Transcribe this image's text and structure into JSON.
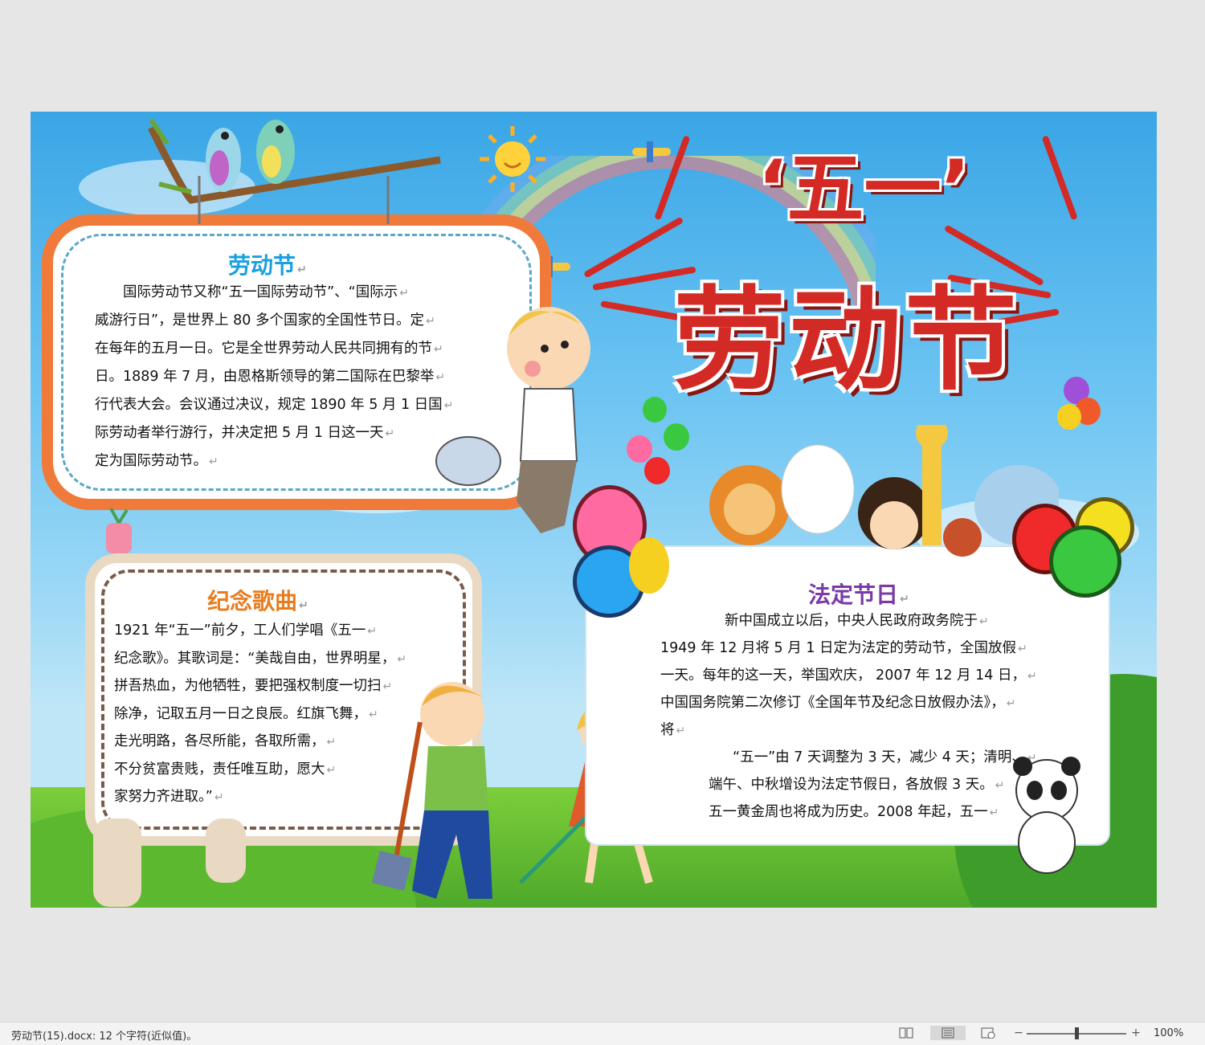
{
  "status_bar": {
    "doc_info": "劳动节(15).docx: 12 个字符(近似值)。",
    "zoom_minus": "−",
    "zoom_plus": "+",
    "zoom_level": "100%",
    "icons": [
      "read-mode-icon",
      "print-layout-icon",
      "web-layout-icon"
    ]
  },
  "poster": {
    "title_line1": "‘五一’",
    "title_line2": "劳动节",
    "panels": [
      {
        "heading": "劳动节",
        "heading_color": "#1aa0e0",
        "lines": [
          "　　国际劳动节又称“五一国际劳动节”、“国际示",
          "威游行日”，是世界上 80 多个国家的全国性节日。定",
          "在每年的五月一日。它是全世界劳动人民共同拥有的节",
          "日。1889 年 7 月，由恩格斯领导的第二国际在巴黎举",
          "行代表大会。会议通过决议，规定 1890 年 5 月 1 日国",
          "际劳动者举行游行，并决定把 5 月 1 日这一天",
          "定为国际劳动节。"
        ]
      },
      {
        "heading": "纪念歌曲",
        "heading_color": "#e87c1e",
        "lines": [
          "1921 年“五一”前夕，工人们学唱《五一",
          "纪念歌》。其歌词是：“美哉自由，世界明星，",
          "拼吾热血，为他牺牲，要把强权制度一切扫",
          "除净，记取五月一日之良辰。红旗飞舞，",
          "走光明路，各尽所能，各取所需，",
          "不分贫富贵贱，责任唯互助，愿大",
          "家努力齐进取。”"
        ]
      },
      {
        "heading": "法定节日",
        "heading_color": "#7a3aa8",
        "lines": [
          "新中国成立以后，中央人民政府政务院于",
          "1949 年 12 月将 5 月 1 日定为法定的劳动节，全国放假",
          "一天。每年的这一天，举国欢庆， 2007 年 12 月 14 日，",
          "中国国务院第二次修订《全国年节及纪念日放假办法》，",
          "将",
          "“五一”由 7 天调整为 3 天，减少 4 天；清明、",
          "端午、中秋增设为法定节假日，各放假 3 天。",
          "五一黄金周也将成为历史。2008 年起，五一"
        ]
      }
    ],
    "colors": {
      "title_red": "#d32a26",
      "frame_orange": "#f07a3a",
      "sky_blue": "#3aa6e6",
      "grass_green": "#4ea82a"
    }
  }
}
